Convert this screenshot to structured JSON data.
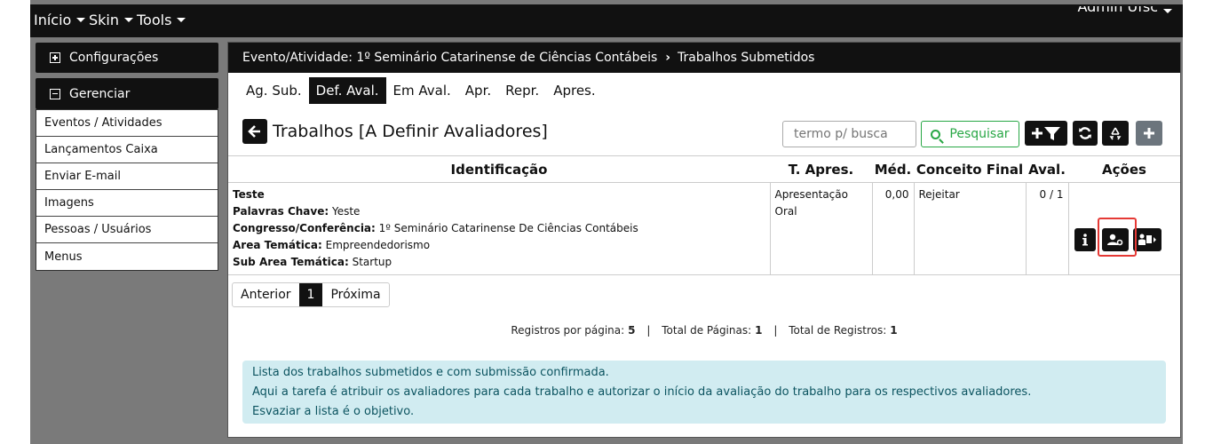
{
  "navbar": {
    "inicio": "Início",
    "skin": "Skin",
    "tools": "Tools",
    "user": "Admin Ufsc"
  },
  "sidebar": {
    "configuracoes": "Configurações",
    "gerenciar": "Gerenciar",
    "items": [
      {
        "label": "Eventos / Atividades"
      },
      {
        "label": "Lançamentos Caixa"
      },
      {
        "label": "Enviar E-mail"
      },
      {
        "label": "Imagens"
      },
      {
        "label": "Pessoas / Usuários"
      },
      {
        "label": "Menus"
      }
    ]
  },
  "breadcrumb": {
    "event": "Evento/Atividade: 1º Seminário Catarinense de Ciências Contábeis",
    "page": "Trabalhos Submetidos"
  },
  "tabs": [
    {
      "label": "Ag. Sub.",
      "active": false
    },
    {
      "label": "Def. Aval.",
      "active": true
    },
    {
      "label": "Em Aval.",
      "active": false
    },
    {
      "label": "Apr.",
      "active": false
    },
    {
      "label": "Repr.",
      "active": false
    },
    {
      "label": "Apres.",
      "active": false
    }
  ],
  "title": "Trabalhos [A Definir Avaliadores]",
  "search": {
    "placeholder": "termo p/ busca",
    "button": "Pesquisar"
  },
  "toolbar_icons": [
    "add-filter-icon",
    "refresh-icon",
    "recycle-icon",
    "plus-icon"
  ],
  "table": {
    "headers": [
      "Identificação",
      "T. Apres.",
      "Méd.",
      "Conceito Final",
      "Aval.",
      "Ações"
    ],
    "row": {
      "title": "Teste",
      "keywords_label": "Palavras Chave:",
      "keywords": "Yeste",
      "congress_label": "Congresso/Conferência:",
      "congress": "1º Seminário Catarinense De Ciências Contábeis",
      "area_label": "Area Temática:",
      "area": "Empreendedorismo",
      "subarea_label": "Sub Area Temática:",
      "subarea": "Startup",
      "t_apres": "Apresentação Oral",
      "med": "0,00",
      "conceito": "Rejeitar",
      "aval": "0 / 1"
    }
  },
  "pagination": {
    "prev": "Anterior",
    "current": "1",
    "next": "Próxima"
  },
  "summary": {
    "per_page_label": "Registros por página:",
    "per_page": "5",
    "pages_label": "Total de Páginas:",
    "pages": "1",
    "records_label": "Total de Registros:",
    "records": "1"
  },
  "info": {
    "line1": "Lista dos trabalhos submetidos e com submissão confirmada.",
    "line2": "Aqui a tarefa é atribuir os avaliadores para cada trabalho e autorizar o início da avaliação do trabalho para os respectivos avaliadores.",
    "line3": "Esvaziar a lista é o objetivo."
  },
  "colors": {
    "dark": "#111111",
    "success": "#28a745",
    "info_bg": "#d1ecf1",
    "info_text": "#0c5460",
    "highlight": "#e53935"
  }
}
